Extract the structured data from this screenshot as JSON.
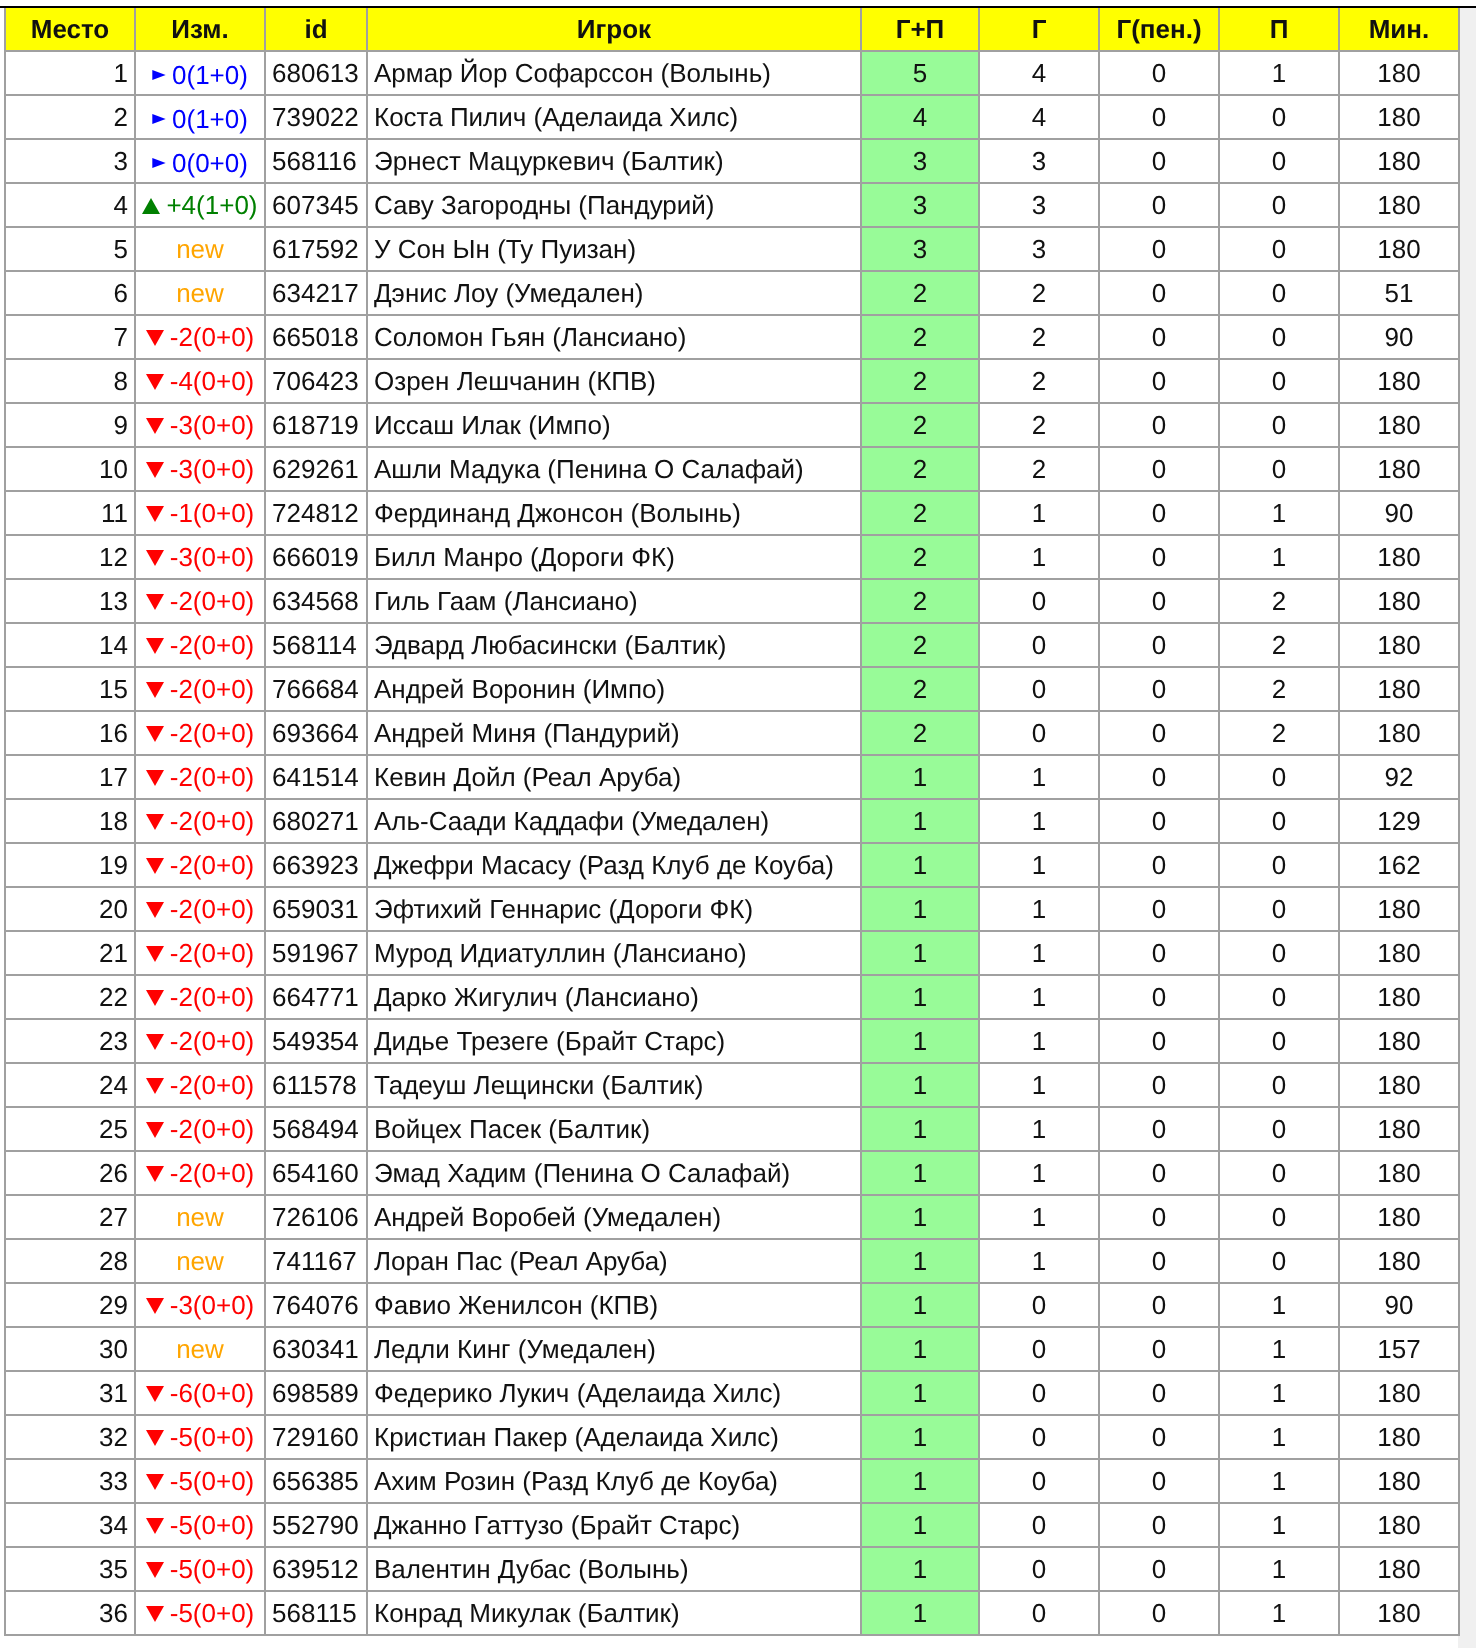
{
  "table": {
    "columns": [
      "Место",
      "Изм.",
      "id",
      "Игрок",
      "Г+П",
      "Г",
      "Г(пен.)",
      "П",
      "Мин."
    ],
    "rows": [
      {
        "place": "1",
        "kind": "same",
        "change": "0(1+0)",
        "id": "680613",
        "player": "Армар Йор Софарссон (Волынь)",
        "gp": "5",
        "g": "4",
        "g_pen": "0",
        "p": "1",
        "min": "180"
      },
      {
        "place": "2",
        "kind": "same",
        "change": "0(1+0)",
        "id": "739022",
        "player": "Коста Пилич (Аделаида Хилс)",
        "gp": "4",
        "g": "4",
        "g_pen": "0",
        "p": "0",
        "min": "180"
      },
      {
        "place": "3",
        "kind": "same",
        "change": "0(0+0)",
        "id": "568116",
        "player": "Эрнест Мацуркевич (Балтик)",
        "gp": "3",
        "g": "3",
        "g_pen": "0",
        "p": "0",
        "min": "180"
      },
      {
        "place": "4",
        "kind": "up",
        "change": "+4(1+0)",
        "id": "607345",
        "player": "Саву Загородны (Пандурий)",
        "gp": "3",
        "g": "3",
        "g_pen": "0",
        "p": "0",
        "min": "180"
      },
      {
        "place": "5",
        "kind": "new",
        "change": "new",
        "id": "617592",
        "player": "У Сон Ын (Ту Пуизан)",
        "gp": "3",
        "g": "3",
        "g_pen": "0",
        "p": "0",
        "min": "180"
      },
      {
        "place": "6",
        "kind": "new",
        "change": "new",
        "id": "634217",
        "player": "Дэнис Лоу (Умедален)",
        "gp": "2",
        "g": "2",
        "g_pen": "0",
        "p": "0",
        "min": "51"
      },
      {
        "place": "7",
        "kind": "down",
        "change": "-2(0+0)",
        "id": "665018",
        "player": "Соломон Гьян (Лансиано)",
        "gp": "2",
        "g": "2",
        "g_pen": "0",
        "p": "0",
        "min": "90"
      },
      {
        "place": "8",
        "kind": "down",
        "change": "-4(0+0)",
        "id": "706423",
        "player": "Озрен Лешчанин (КПВ)",
        "gp": "2",
        "g": "2",
        "g_pen": "0",
        "p": "0",
        "min": "180"
      },
      {
        "place": "9",
        "kind": "down",
        "change": "-3(0+0)",
        "id": "618719",
        "player": "Иссаш Илак (Импо)",
        "gp": "2",
        "g": "2",
        "g_pen": "0",
        "p": "0",
        "min": "180"
      },
      {
        "place": "10",
        "kind": "down",
        "change": "-3(0+0)",
        "id": "629261",
        "player": "Ашли Мадука (Пенина О Салафай)",
        "gp": "2",
        "g": "2",
        "g_pen": "0",
        "p": "0",
        "min": "180"
      },
      {
        "place": "11",
        "kind": "down",
        "change": "-1(0+0)",
        "id": "724812",
        "player": "Фердинанд Джонсон (Волынь)",
        "gp": "2",
        "g": "1",
        "g_pen": "0",
        "p": "1",
        "min": "90"
      },
      {
        "place": "12",
        "kind": "down",
        "change": "-3(0+0)",
        "id": "666019",
        "player": "Билл Манро (Дороги ФК)",
        "gp": "2",
        "g": "1",
        "g_pen": "0",
        "p": "1",
        "min": "180"
      },
      {
        "place": "13",
        "kind": "down",
        "change": "-2(0+0)",
        "id": "634568",
        "player": "Гиль Гаам (Лансиано)",
        "gp": "2",
        "g": "0",
        "g_pen": "0",
        "p": "2",
        "min": "180"
      },
      {
        "place": "14",
        "kind": "down",
        "change": "-2(0+0)",
        "id": "568114",
        "player": "Эдвард Любасински (Балтик)",
        "gp": "2",
        "g": "0",
        "g_pen": "0",
        "p": "2",
        "min": "180"
      },
      {
        "place": "15",
        "kind": "down",
        "change": "-2(0+0)",
        "id": "766684",
        "player": "Андрей Воронин (Импо)",
        "gp": "2",
        "g": "0",
        "g_pen": "0",
        "p": "2",
        "min": "180"
      },
      {
        "place": "16",
        "kind": "down",
        "change": "-2(0+0)",
        "id": "693664",
        "player": "Андрей Миня (Пандурий)",
        "gp": "2",
        "g": "0",
        "g_pen": "0",
        "p": "2",
        "min": "180"
      },
      {
        "place": "17",
        "kind": "down",
        "change": "-2(0+0)",
        "id": "641514",
        "player": "Кевин Дойл (Реал Аруба)",
        "gp": "1",
        "g": "1",
        "g_pen": "0",
        "p": "0",
        "min": "92"
      },
      {
        "place": "18",
        "kind": "down",
        "change": "-2(0+0)",
        "id": "680271",
        "player": "Аль-Саади Каддафи (Умедален)",
        "gp": "1",
        "g": "1",
        "g_pen": "0",
        "p": "0",
        "min": "129"
      },
      {
        "place": "19",
        "kind": "down",
        "change": "-2(0+0)",
        "id": "663923",
        "player": "Джефри Масасу (Разд Клуб де Коуба)",
        "gp": "1",
        "g": "1",
        "g_pen": "0",
        "p": "0",
        "min": "162"
      },
      {
        "place": "20",
        "kind": "down",
        "change": "-2(0+0)",
        "id": "659031",
        "player": "Эфтихий Геннарис (Дороги ФК)",
        "gp": "1",
        "g": "1",
        "g_pen": "0",
        "p": "0",
        "min": "180"
      },
      {
        "place": "21",
        "kind": "down",
        "change": "-2(0+0)",
        "id": "591967",
        "player": "Мурод Идиатуллин (Лансиано)",
        "gp": "1",
        "g": "1",
        "g_pen": "0",
        "p": "0",
        "min": "180"
      },
      {
        "place": "22",
        "kind": "down",
        "change": "-2(0+0)",
        "id": "664771",
        "player": "Дарко Жигулич (Лансиано)",
        "gp": "1",
        "g": "1",
        "g_pen": "0",
        "p": "0",
        "min": "180"
      },
      {
        "place": "23",
        "kind": "down",
        "change": "-2(0+0)",
        "id": "549354",
        "player": "Дидье Трезеге (Брайт Старс)",
        "gp": "1",
        "g": "1",
        "g_pen": "0",
        "p": "0",
        "min": "180"
      },
      {
        "place": "24",
        "kind": "down",
        "change": "-2(0+0)",
        "id": "611578",
        "player": "Тадеуш Лещински (Балтик)",
        "gp": "1",
        "g": "1",
        "g_pen": "0",
        "p": "0",
        "min": "180"
      },
      {
        "place": "25",
        "kind": "down",
        "change": "-2(0+0)",
        "id": "568494",
        "player": "Войцех Пасек (Балтик)",
        "gp": "1",
        "g": "1",
        "g_pen": "0",
        "p": "0",
        "min": "180"
      },
      {
        "place": "26",
        "kind": "down",
        "change": "-2(0+0)",
        "id": "654160",
        "player": "Эмад Хадим (Пенина О Салафай)",
        "gp": "1",
        "g": "1",
        "g_pen": "0",
        "p": "0",
        "min": "180"
      },
      {
        "place": "27",
        "kind": "new",
        "change": "new",
        "id": "726106",
        "player": "Андрей Воробей (Умедален)",
        "gp": "1",
        "g": "1",
        "g_pen": "0",
        "p": "0",
        "min": "180"
      },
      {
        "place": "28",
        "kind": "new",
        "change": "new",
        "id": "741167",
        "player": "Лоран Пас (Реал Аруба)",
        "gp": "1",
        "g": "1",
        "g_pen": "0",
        "p": "0",
        "min": "180"
      },
      {
        "place": "29",
        "kind": "down",
        "change": "-3(0+0)",
        "id": "764076",
        "player": "Фавио Женилсон (КПВ)",
        "gp": "1",
        "g": "0",
        "g_pen": "0",
        "p": "1",
        "min": "90"
      },
      {
        "place": "30",
        "kind": "new",
        "change": "new",
        "id": "630341",
        "player": "Ледли Кинг (Умедален)",
        "gp": "1",
        "g": "0",
        "g_pen": "0",
        "p": "1",
        "min": "157"
      },
      {
        "place": "31",
        "kind": "down",
        "change": "-6(0+0)",
        "id": "698589",
        "player": "Федерико Лукич (Аделаида Хилс)",
        "gp": "1",
        "g": "0",
        "g_pen": "0",
        "p": "1",
        "min": "180"
      },
      {
        "place": "32",
        "kind": "down",
        "change": "-5(0+0)",
        "id": "729160",
        "player": "Кристиан Пакер (Аделаида Хилс)",
        "gp": "1",
        "g": "0",
        "g_pen": "0",
        "p": "1",
        "min": "180"
      },
      {
        "place": "33",
        "kind": "down",
        "change": "-5(0+0)",
        "id": "656385",
        "player": "Ахим Розин (Разд Клуб де Коуба)",
        "gp": "1",
        "g": "0",
        "g_pen": "0",
        "p": "1",
        "min": "180"
      },
      {
        "place": "34",
        "kind": "down",
        "change": "-5(0+0)",
        "id": "552790",
        "player": "Джанно Гаттузо (Брайт Старс)",
        "gp": "1",
        "g": "0",
        "g_pen": "0",
        "p": "1",
        "min": "180"
      },
      {
        "place": "35",
        "kind": "down",
        "change": "-5(0+0)",
        "id": "639512",
        "player": "Валентин Дубас (Волынь)",
        "gp": "1",
        "g": "0",
        "g_pen": "0",
        "p": "1",
        "min": "180"
      },
      {
        "place": "36",
        "kind": "down",
        "change": "-5(0+0)",
        "id": "568115",
        "player": "Конрад Микулак (Балтик)",
        "gp": "1",
        "g": "0",
        "g_pen": "0",
        "p": "1",
        "min": "180"
      }
    ]
  }
}
